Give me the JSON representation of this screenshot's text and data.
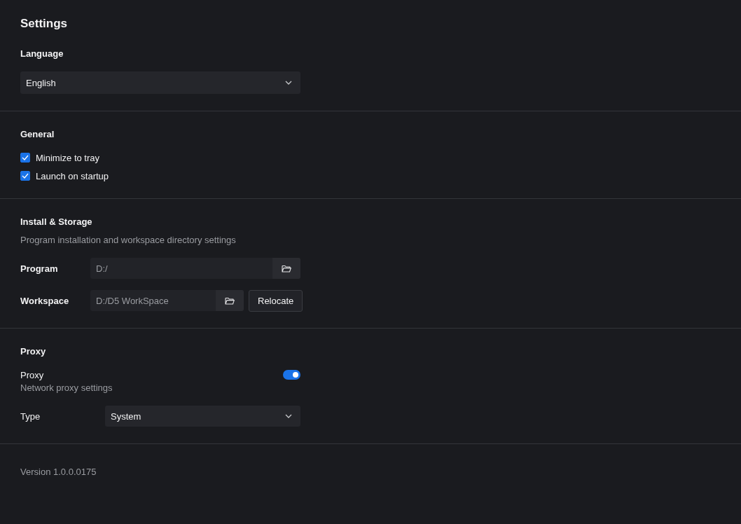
{
  "title": "Settings",
  "language": {
    "heading": "Language",
    "value": "English"
  },
  "general": {
    "heading": "General",
    "options": [
      {
        "label": "Minimize to tray",
        "checked": true
      },
      {
        "label": "Launch on startup",
        "checked": true
      }
    ]
  },
  "storage": {
    "heading": "Install & Storage",
    "description": "Program installation and workspace directory settings",
    "program": {
      "label": "Program",
      "value": "D:/"
    },
    "workspace": {
      "label": "Workspace",
      "value": "D:/D5 WorkSpace",
      "button": "Relocate"
    }
  },
  "proxy": {
    "heading": "Proxy",
    "toggle_label": "Proxy",
    "on": true,
    "description": "Network proxy settings",
    "type_label": "Type",
    "type_value": "System"
  },
  "version": "Version 1.0.0.0175"
}
